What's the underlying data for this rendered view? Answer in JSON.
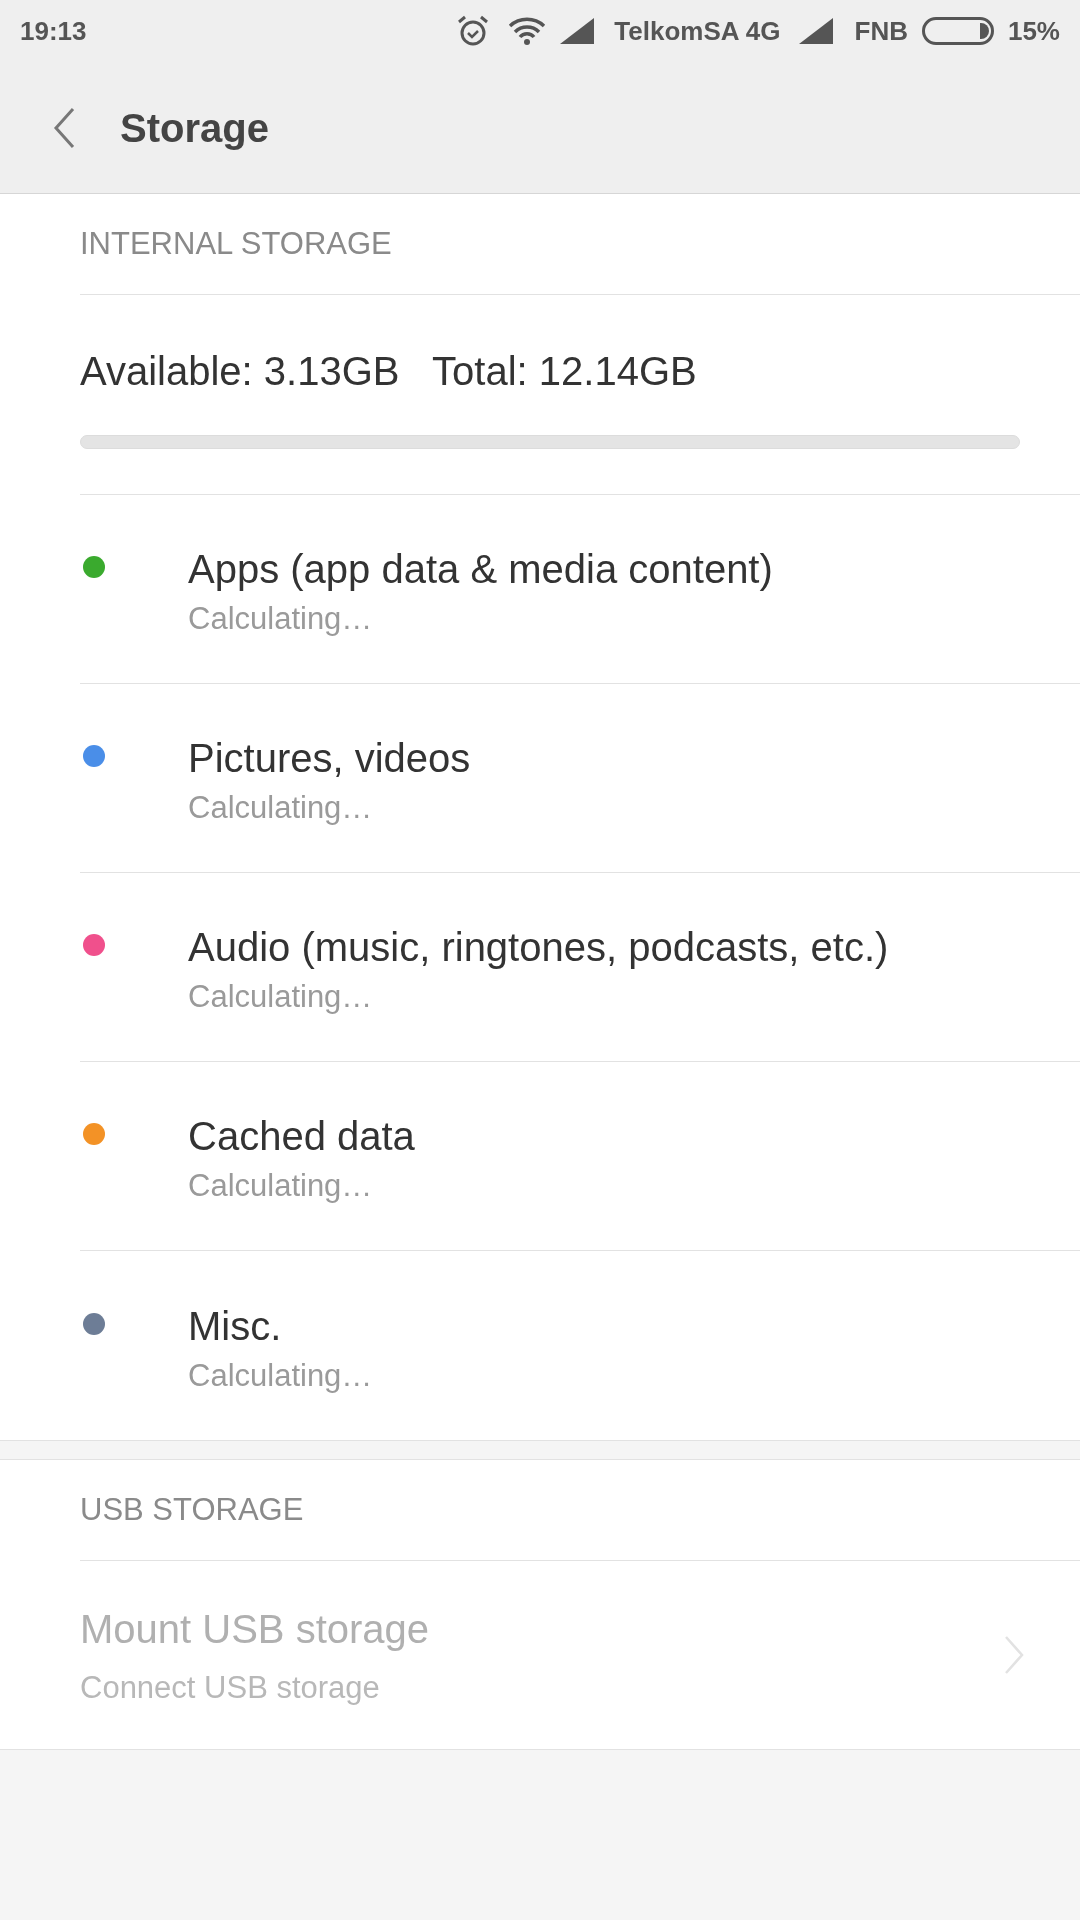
{
  "status_bar": {
    "time": "19:13",
    "carrier_1": "TelkomSA 4G",
    "carrier_2": "FNB",
    "battery": "15%"
  },
  "toolbar": {
    "title": "Storage"
  },
  "internal_storage": {
    "header": "INTERNAL STORAGE",
    "summary": "Available: 3.13GB   Total: 12.14GB",
    "level": 0,
    "items": [
      {
        "title": "Apps (app data & media content)",
        "subtitle": "Calculating…",
        "color": "#3aaa2e"
      },
      {
        "title": "Pictures, videos",
        "subtitle": "Calculating…",
        "color": "#4a8ee8"
      },
      {
        "title": "Audio (music, ringtones, podcasts, etc.)",
        "subtitle": "Calculating…",
        "color": "#f0508c"
      },
      {
        "title": "Cached data",
        "subtitle": "Calculating…",
        "color": "#f39226"
      },
      {
        "title": "Misc.",
        "subtitle": "Calculating…",
        "color": "#6d7d96"
      }
    ]
  },
  "usb_storage": {
    "header": "USB STORAGE",
    "items": [
      {
        "title": "Mount USB storage",
        "subtitle": "Connect USB storage",
        "disabled": true
      }
    ]
  }
}
